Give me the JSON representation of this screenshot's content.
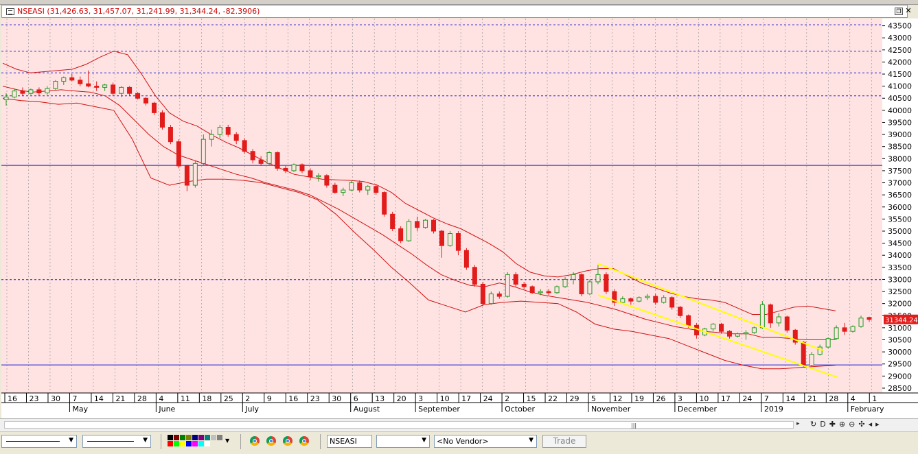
{
  "window": {
    "symbol": "NSEASI",
    "title_values": "(31,426.63, 31,457.07, 31,241.99, 31,344.24, -82.3906)"
  },
  "toolbar": {
    "symbol_field": "NSEASI",
    "vendor_select": "<No Vendor>",
    "trade_button": "Trade",
    "palette_colors": [
      "#000000",
      "#800000",
      "#008000",
      "#808000",
      "#000080",
      "#800080",
      "#008080",
      "#c0c0c0",
      "#808080",
      "#ff0000",
      "#00ff00",
      "#ffff00",
      "#0000ff",
      "#ff00ff",
      "#00ffff",
      "#ffffff"
    ]
  },
  "nav": {
    "icons": [
      "refresh-icon",
      "daily-icon",
      "crosshair-icon",
      "zoom-in-icon",
      "zoom-out-icon",
      "scroll-icon",
      "left-icon",
      "right-icon"
    ],
    "labels": [
      "↻",
      "D",
      "✚",
      "⊕",
      "⊖",
      "✣",
      "◂",
      "▸"
    ]
  },
  "chart_data": {
    "type": "candlestick",
    "background": "#ffe3e3",
    "up_color": "#1f9a1f",
    "down_color": "#e21b1b",
    "band_color": "#d01010",
    "channel_color": "#ffff00",
    "last_price_label": "31344.24",
    "y_ticks": [
      28500,
      29000,
      29500,
      30000,
      30500,
      31000,
      31500,
      32000,
      32500,
      33000,
      33500,
      34000,
      34500,
      35000,
      35500,
      36000,
      36500,
      37000,
      37500,
      38000,
      38500,
      39000,
      39500,
      40000,
      40500,
      41000,
      41500,
      42000,
      42500,
      43000,
      43500
    ],
    "y_range": [
      28300,
      43800
    ],
    "x_date_labels": [
      "16",
      "23",
      "30",
      "7",
      "14",
      "21",
      "28",
      "4",
      "11",
      "18",
      "25",
      "2",
      "9",
      "16",
      "23",
      "30",
      "6",
      "13",
      "20",
      "3",
      "10",
      "17",
      "24",
      "2",
      "15",
      "22",
      "29",
      "5",
      "12",
      "19",
      "26",
      "3",
      "10",
      "17",
      "24",
      "7",
      "14",
      "21",
      "28",
      "4",
      "1"
    ],
    "month_labels": [
      "May",
      "June",
      "July",
      "August",
      "September",
      "October",
      "November",
      "December",
      "2019",
      "February"
    ],
    "h_lines": [
      {
        "value": 43540,
        "style": "dashed"
      },
      {
        "value": 42450,
        "style": "dashed"
      },
      {
        "value": 41550,
        "style": "dashed"
      },
      {
        "value": 40600,
        "style": "dashed"
      },
      {
        "value": 37720,
        "style": "solid"
      },
      {
        "value": 32990,
        "style": "dashed"
      },
      {
        "value": 29460,
        "style": "solid"
      }
    ],
    "candles": [
      [
        40440,
        40710,
        40200,
        40550
      ],
      [
        40550,
        40900,
        40500,
        40800
      ],
      [
        40800,
        40950,
        40600,
        40700
      ],
      [
        40700,
        40900,
        40650,
        40850
      ],
      [
        40850,
        40950,
        40600,
        40720
      ],
      [
        40720,
        41000,
        40650,
        40900
      ],
      [
        40900,
        41250,
        40850,
        41200
      ],
      [
        41200,
        41400,
        41050,
        41350
      ],
      [
        41350,
        41500,
        41200,
        41250
      ],
      [
        41250,
        41400,
        41000,
        41100
      ],
      [
        41100,
        41650,
        40950,
        41000
      ],
      [
        41000,
        41200,
        40800,
        40950
      ],
      [
        40950,
        41100,
        40800,
        41050
      ],
      [
        41050,
        41150,
        40600,
        40700
      ],
      [
        40700,
        41000,
        40550,
        40950
      ],
      [
        40950,
        41000,
        40600,
        40700
      ],
      [
        40700,
        40750,
        40450,
        40500
      ],
      [
        40500,
        40550,
        40200,
        40300
      ],
      [
        40300,
        40350,
        39800,
        39900
      ],
      [
        39900,
        40000,
        39200,
        39300
      ],
      [
        39300,
        39400,
        38600,
        38700
      ],
      [
        38700,
        38800,
        37600,
        37700
      ],
      [
        37700,
        37750,
        36650,
        36900
      ],
      [
        36900,
        37900,
        36800,
        37800
      ],
      [
        37800,
        39000,
        37700,
        38800
      ],
      [
        38800,
        39200,
        38500,
        39000
      ],
      [
        39000,
        39400,
        38850,
        39300
      ],
      [
        39300,
        39400,
        38900,
        39000
      ],
      [
        39000,
        39100,
        38600,
        38750
      ],
      [
        38750,
        38850,
        38200,
        38300
      ],
      [
        38300,
        38400,
        37800,
        37950
      ],
      [
        37950,
        38100,
        37700,
        37800
      ],
      [
        37800,
        38300,
        37700,
        38250
      ],
      [
        38250,
        38300,
        37500,
        37600
      ],
      [
        37600,
        37700,
        37400,
        37500
      ],
      [
        37500,
        37800,
        37450,
        37750
      ],
      [
        37750,
        37800,
        37400,
        37500
      ],
      [
        37500,
        37600,
        37100,
        37250
      ],
      [
        37250,
        37400,
        37050,
        37300
      ],
      [
        37300,
        37350,
        36800,
        36900
      ],
      [
        36900,
        37000,
        36550,
        36600
      ],
      [
        36600,
        36800,
        36450,
        36700
      ],
      [
        36700,
        37100,
        36650,
        37000
      ],
      [
        37000,
        37100,
        36600,
        36700
      ],
      [
        36700,
        36900,
        36500,
        36850
      ],
      [
        36850,
        36950,
        36500,
        36600
      ],
      [
        36600,
        36650,
        35600,
        35700
      ],
      [
        35700,
        35800,
        35000,
        35100
      ],
      [
        35100,
        35200,
        34500,
        34600
      ],
      [
        34600,
        35500,
        34550,
        35400
      ],
      [
        35400,
        35600,
        35000,
        35150
      ],
      [
        35150,
        35500,
        35100,
        35450
      ],
      [
        35450,
        35500,
        34900,
        35000
      ],
      [
        35000,
        35050,
        33900,
        34400
      ],
      [
        34400,
        35000,
        34350,
        34900
      ],
      [
        34900,
        35000,
        34000,
        34200
      ],
      [
        34200,
        34300,
        33400,
        33500
      ],
      [
        33500,
        33600,
        32700,
        32800
      ],
      [
        32800,
        32900,
        31900,
        32000
      ],
      [
        32000,
        32500,
        31950,
        32400
      ],
      [
        32400,
        32500,
        32200,
        32300
      ],
      [
        32300,
        33300,
        32250,
        33200
      ],
      [
        33200,
        33300,
        32700,
        32800
      ],
      [
        32800,
        32900,
        32600,
        32700
      ],
      [
        32700,
        32750,
        32400,
        32450
      ],
      [
        32450,
        32600,
        32350,
        32500
      ],
      [
        32500,
        32600,
        32350,
        32450
      ],
      [
        32450,
        32750,
        32400,
        32700
      ],
      [
        32700,
        33100,
        32650,
        33000
      ],
      [
        33000,
        33300,
        32800,
        33200
      ],
      [
        33200,
        33250,
        32300,
        32400
      ],
      [
        32400,
        33000,
        32350,
        32900
      ],
      [
        32900,
        33600,
        32800,
        33200
      ],
      [
        33200,
        33300,
        32400,
        32500
      ],
      [
        32500,
        32600,
        31900,
        32050
      ],
      [
        32050,
        32300,
        32000,
        32200
      ],
      [
        32200,
        32250,
        31950,
        32100
      ],
      [
        32100,
        32300,
        32050,
        32250
      ],
      [
        32250,
        32400,
        32150,
        32300
      ],
      [
        32300,
        32400,
        31950,
        32050
      ],
      [
        32050,
        32350,
        32000,
        32250
      ],
      [
        32250,
        32300,
        31750,
        31850
      ],
      [
        31850,
        31900,
        31400,
        31500
      ],
      [
        31500,
        31550,
        31000,
        31100
      ],
      [
        31100,
        31200,
        30550,
        30700
      ],
      [
        30700,
        31000,
        30650,
        30950
      ],
      [
        30950,
        31200,
        30850,
        31150
      ],
      [
        31150,
        31200,
        30750,
        30850
      ],
      [
        30850,
        30900,
        30550,
        30650
      ],
      [
        30650,
        30800,
        30600,
        30750
      ],
      [
        30750,
        30900,
        30500,
        30800
      ],
      [
        30800,
        31050,
        30750,
        31000
      ],
      [
        31000,
        32100,
        30950,
        31950
      ],
      [
        31950,
        32000,
        31000,
        31200
      ],
      [
        31200,
        31600,
        31050,
        31450
      ],
      [
        31450,
        31500,
        30800,
        30900
      ],
      [
        30900,
        30950,
        30300,
        30400
      ],
      [
        30400,
        30450,
        29350,
        29450
      ],
      [
        29450,
        30000,
        29400,
        29900
      ],
      [
        29900,
        30300,
        29850,
        30200
      ],
      [
        30200,
        30600,
        30150,
        30550
      ],
      [
        30550,
        31100,
        30500,
        31000
      ],
      [
        31000,
        31200,
        30700,
        30850
      ],
      [
        30850,
        31100,
        30800,
        31050
      ],
      [
        31050,
        31500,
        31000,
        31400
      ],
      [
        31426.63,
        31457.07,
        31241.99,
        31344.24
      ]
    ],
    "upper_band": [
      41950,
      41700,
      41550,
      41600,
      41650,
      41700,
      41900,
      42200,
      42450,
      42300,
      41500,
      40600,
      39900,
      39550,
      39350,
      39000,
      38700,
      38450,
      38150,
      37850,
      37600,
      37350,
      37250,
      37150,
      37120,
      37100,
      37050,
      36900,
      36600,
      36150,
      35850,
      35550,
      35300,
      35100,
      34800,
      34500,
      34150,
      33650,
      33300,
      33150,
      33100,
      33200,
      33350,
      33450,
      33450,
      33150,
      32850,
      32650,
      32450,
      32300,
      32200,
      32150,
      32050,
      31800,
      31550,
      31550,
      31700,
      31850,
      31900,
      31800,
      31700
    ],
    "middle_band": [
      41000,
      40850,
      40750,
      40800,
      40850,
      40800,
      40750,
      40600,
      40200,
      39600,
      39000,
      38500,
      38150,
      37950,
      37750,
      37550,
      37350,
      37200,
      37000,
      36850,
      36700,
      36500,
      36200,
      35900,
      35550,
      35200,
      34850,
      34450,
      34050,
      33600,
      33200,
      32950,
      32750,
      32700,
      32850,
      32700,
      32500,
      32350,
      32250,
      32150,
      32050,
      31900,
      31750,
      31550,
      31350,
      31200,
      31050,
      30950,
      30850,
      30800,
      30750,
      30750,
      30600,
      30600,
      30550,
      30500,
      30500,
      30500
    ],
    "lower_band": [
      40500,
      40400,
      40350,
      40250,
      40300,
      40150,
      40000,
      38800,
      37200,
      36900,
      37050,
      37150,
      37150,
      37100,
      37000,
      36800,
      36600,
      36300,
      35700,
      34950,
      34250,
      33500,
      32850,
      32150,
      31900,
      31650,
      31950,
      32050,
      32100,
      32050,
      32000,
      31650,
      31150,
      30950,
      30850,
      30700,
      30550,
      30250,
      29950,
      29650,
      29450,
      29300,
      29300,
      29350,
      29400,
      29450
    ],
    "channel_lines": [
      {
        "x0": 0.651,
        "y0": 33650,
        "x1": 0.897,
        "y1": 30050
      },
      {
        "x0": 0.651,
        "y0": 32350,
        "x1": 0.912,
        "y1": 28950
      }
    ]
  }
}
